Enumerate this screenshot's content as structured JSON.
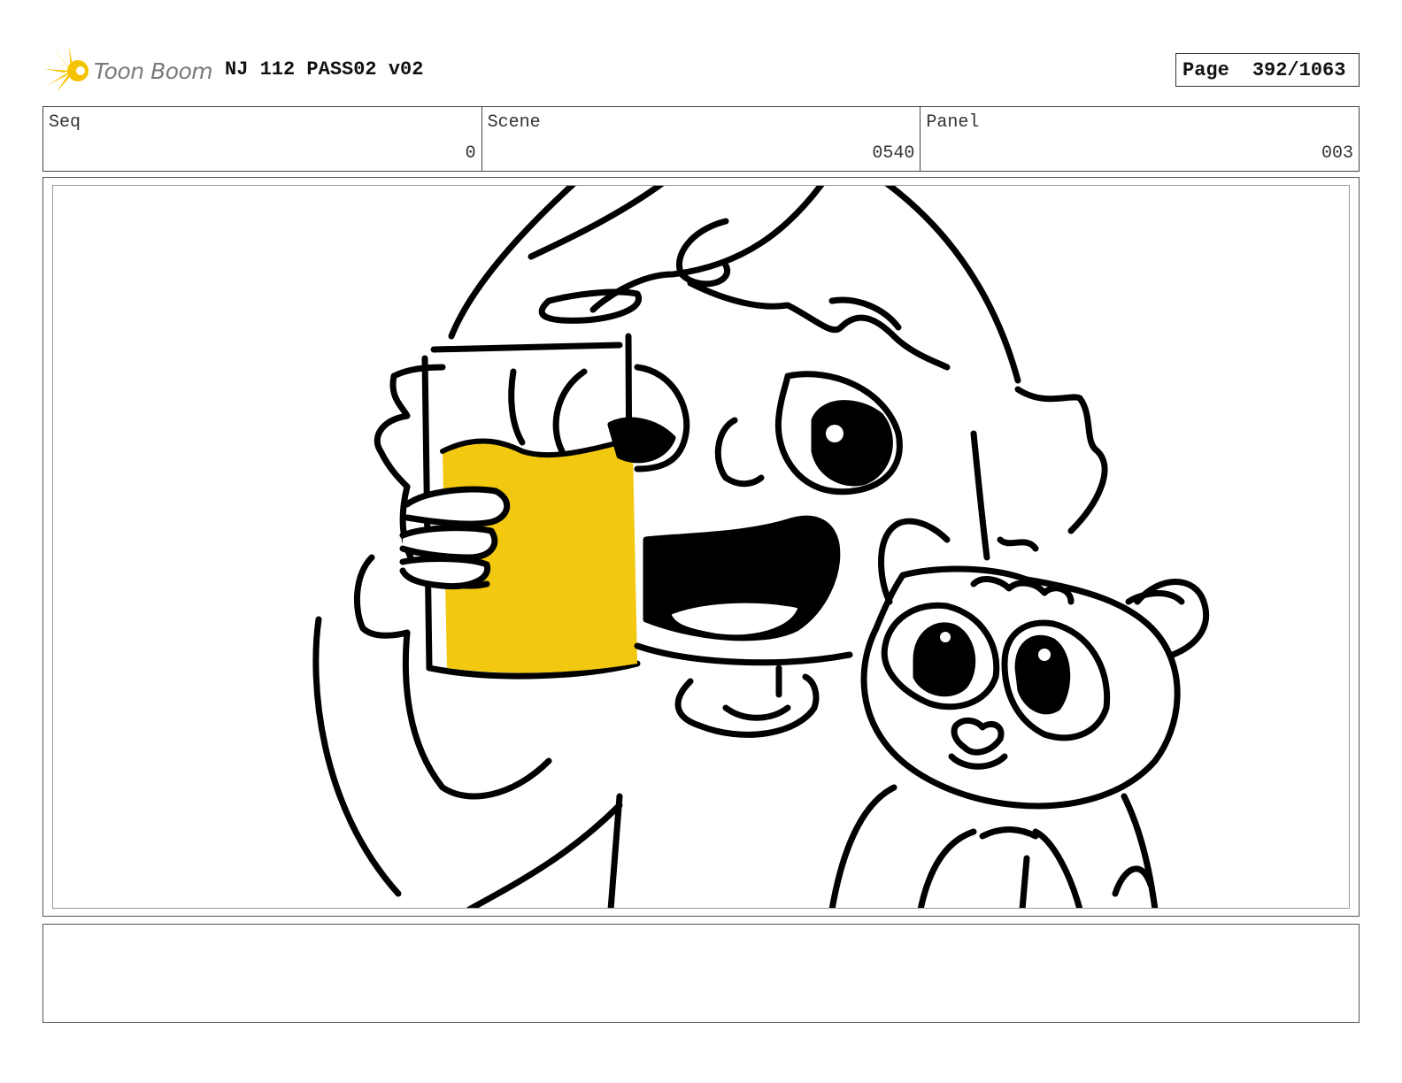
{
  "header": {
    "logo_text": "Toon Boom",
    "project_title": "NJ 112 PASS02 v02",
    "page_label": "Page",
    "page_number": "392/1063"
  },
  "fields": [
    {
      "label": "Seq",
      "value": "0"
    },
    {
      "label": "Scene",
      "value": "0540"
    },
    {
      "label": "Panel",
      "value": "003"
    }
  ],
  "panel": {
    "drawing": "storyboard sketch",
    "fill_color": "#F2C811",
    "line_color": "#000000"
  },
  "notes": {
    "text": ""
  }
}
